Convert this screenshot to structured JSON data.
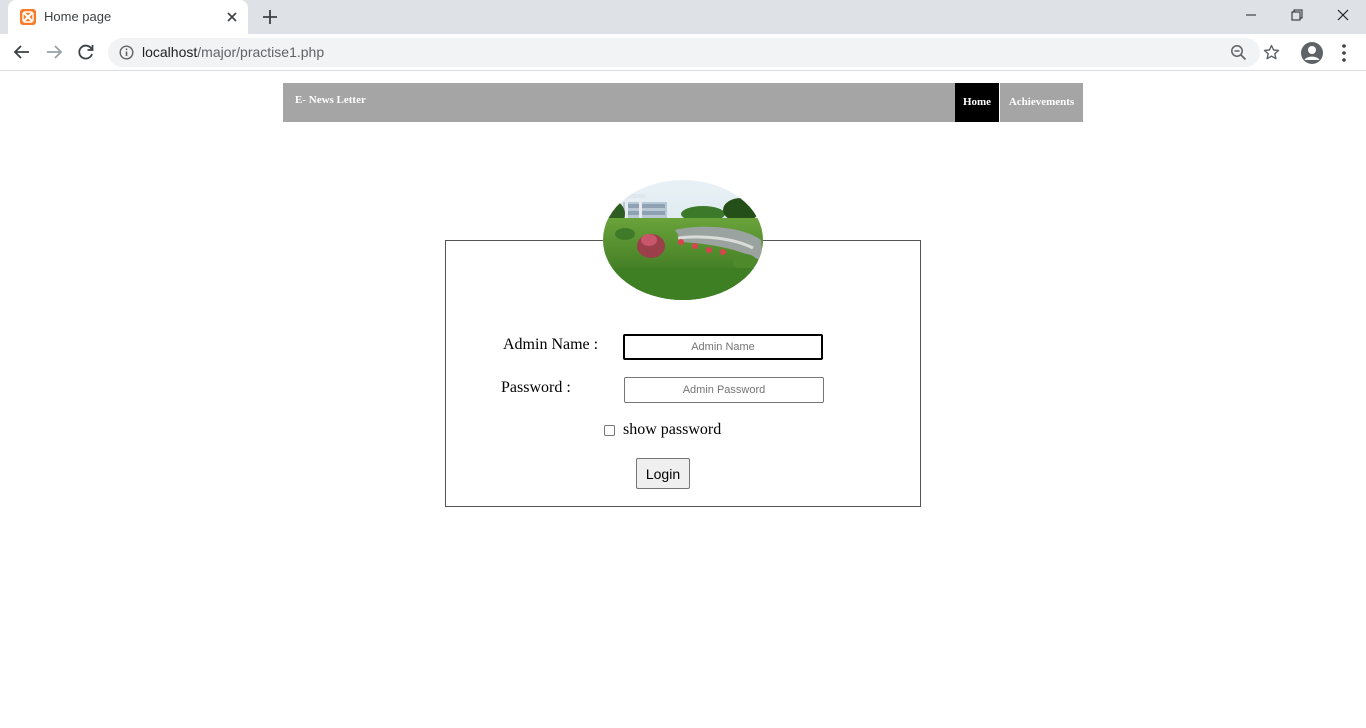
{
  "browser": {
    "tab_title": "Home page",
    "url_host": "localhost",
    "url_path": "/major/practise1.php"
  },
  "navbar": {
    "brand": "E- News Letter",
    "items": [
      {
        "label": "Home"
      },
      {
        "label": "Achievements"
      }
    ]
  },
  "login": {
    "admin_name_label": "Admin Name :",
    "admin_name_placeholder": "Admin Name",
    "password_label": "Password :",
    "password_placeholder": "Admin Password",
    "show_password_label": "show password",
    "login_button": "Login"
  },
  "colors": {
    "navbar_bg": "#a5a5a5",
    "nav_active_bg": "#000000",
    "tab_strip_bg": "#dee1e6",
    "favicon": "#fb7a24"
  }
}
